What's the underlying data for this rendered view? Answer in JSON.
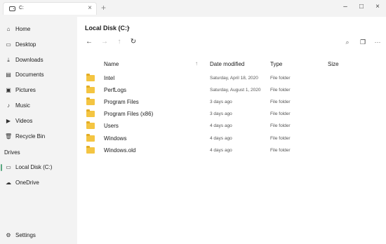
{
  "tab": {
    "title": "C:",
    "close": "×"
  },
  "new_tab": "+",
  "window_controls": {
    "minimize": "–",
    "maximize": "□",
    "close": "×"
  },
  "sidebar": {
    "items": [
      {
        "label": "Home",
        "icon": "home-icon",
        "glyph": "⌂"
      },
      {
        "label": "Desktop",
        "icon": "desktop-icon",
        "glyph": "▭"
      },
      {
        "label": "Downloads",
        "icon": "download-icon",
        "glyph": "⤓"
      },
      {
        "label": "Documents",
        "icon": "document-icon",
        "glyph": "▤"
      },
      {
        "label": "Pictures",
        "icon": "picture-icon",
        "glyph": "▣"
      },
      {
        "label": "Music",
        "icon": "music-icon",
        "glyph": "♪"
      },
      {
        "label": "Videos",
        "icon": "video-icon",
        "glyph": "▶"
      },
      {
        "label": "Recycle Bin",
        "icon": "recycle-bin-icon",
        "glyph": "🗑"
      }
    ],
    "drives_header": "Drives",
    "drives": [
      {
        "label": "Local Disk (C:)",
        "icon": "drive-icon",
        "glyph": "▭",
        "active": true
      },
      {
        "label": "OneDrive",
        "icon": "cloud-icon",
        "glyph": "☁"
      }
    ],
    "settings": {
      "label": "Settings",
      "icon": "gear-icon",
      "glyph": "⚙"
    }
  },
  "breadcrumb": {
    "current": "Local Disk (C:)",
    "separator": "›"
  },
  "toolbar": {
    "back": "←",
    "forward": "→",
    "up": "↑",
    "refresh": "↻",
    "search": "⌕",
    "view": "❐",
    "more": "···"
  },
  "columns": {
    "name": "Name",
    "date": "Date modified",
    "type": "Type",
    "size": "Size",
    "sort_arrow": "↑"
  },
  "files": [
    {
      "name": "Intel",
      "date": "Saturday, April 18, 2020",
      "type": "File folder"
    },
    {
      "name": "PerfLogs",
      "date": "Saturday, August 1, 2020",
      "type": "File folder"
    },
    {
      "name": "Program Files",
      "date": "3 days ago",
      "type": "File folder"
    },
    {
      "name": "Program Files (x86)",
      "date": "3 days ago",
      "type": "File folder"
    },
    {
      "name": "Users",
      "date": "4 days ago",
      "type": "File folder"
    },
    {
      "name": "Windows",
      "date": "4 days ago",
      "type": "File folder"
    },
    {
      "name": "Windows.old",
      "date": "4 days ago",
      "type": "File folder"
    }
  ],
  "colors": {
    "folder": "#f4c542",
    "accent": "#5aa880"
  }
}
